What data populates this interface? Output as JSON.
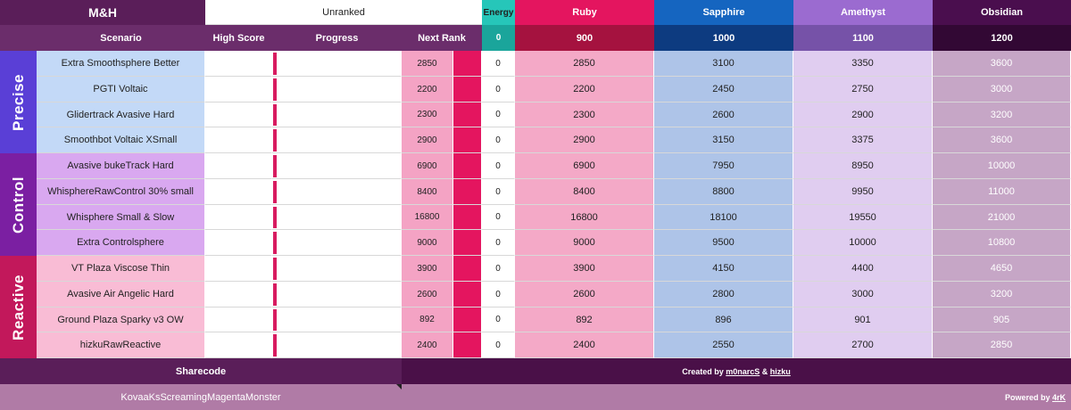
{
  "header": {
    "title": "M&H",
    "rank_status": "Unranked",
    "energy_label": "Energy",
    "energy_value": "0",
    "ranks": [
      {
        "name": "Ruby",
        "threshold": "900"
      },
      {
        "name": "Sapphire",
        "threshold": "1000"
      },
      {
        "name": "Amethyst",
        "threshold": "1100"
      },
      {
        "name": "Obsidian",
        "threshold": "1200"
      }
    ],
    "columns": {
      "scenario": "Scenario",
      "high_score": "High Score",
      "progress": "Progress",
      "next_rank": "Next Rank"
    }
  },
  "categories": [
    {
      "name": "Precise",
      "color": "#5a3fd6"
    },
    {
      "name": "Control",
      "color": "#7b1fa2"
    },
    {
      "name": "Reactive",
      "color": "#c2185b"
    }
  ],
  "scenarios": [
    {
      "name": "Extra Smoothsphere Better",
      "next_rank": "2850",
      "energy": "0",
      "ruby": "2850",
      "sapphire": "3100",
      "amethyst": "3350",
      "obsidian": "3600"
    },
    {
      "name": "PGTI Voltaic",
      "next_rank": "2200",
      "energy": "0",
      "ruby": "2200",
      "sapphire": "2450",
      "amethyst": "2750",
      "obsidian": "3000"
    },
    {
      "name": "Glidertrack Avasive Hard",
      "next_rank": "2300",
      "energy": "0",
      "ruby": "2300",
      "sapphire": "2600",
      "amethyst": "2900",
      "obsidian": "3200"
    },
    {
      "name": "Smoothbot Voltaic XSmall",
      "next_rank": "2900",
      "energy": "0",
      "ruby": "2900",
      "sapphire": "3150",
      "amethyst": "3375",
      "obsidian": "3600"
    },
    {
      "name": "Avasive bukeTrack Hard",
      "next_rank": "6900",
      "energy": "0",
      "ruby": "6900",
      "sapphire": "7950",
      "amethyst": "8950",
      "obsidian": "10000"
    },
    {
      "name": "WhisphereRawControl 30% small",
      "next_rank": "8400",
      "energy": "0",
      "ruby": "8400",
      "sapphire": "8800",
      "amethyst": "9950",
      "obsidian": "11000"
    },
    {
      "name": "Whisphere Small & Slow",
      "next_rank": "16800",
      "energy": "0",
      "ruby": "16800",
      "sapphire": "18100",
      "amethyst": "19550",
      "obsidian": "21000"
    },
    {
      "name": "Extra Controlsphere",
      "next_rank": "9000",
      "energy": "0",
      "ruby": "9000",
      "sapphire": "9500",
      "amethyst": "10000",
      "obsidian": "10800"
    },
    {
      "name": "VT Plaza Viscose Thin",
      "next_rank": "3900",
      "energy": "0",
      "ruby": "3900",
      "sapphire": "4150",
      "amethyst": "4400",
      "obsidian": "4650"
    },
    {
      "name": "Avasive Air Angelic Hard",
      "next_rank": "2600",
      "energy": "0",
      "ruby": "2600",
      "sapphire": "2800",
      "amethyst": "3000",
      "obsidian": "3200"
    },
    {
      "name": "Ground Plaza Sparky v3 OW",
      "next_rank": "892",
      "energy": "0",
      "ruby": "892",
      "sapphire": "896",
      "amethyst": "901",
      "obsidian": "905"
    },
    {
      "name": "hizkuRawReactive",
      "next_rank": "2400",
      "energy": "0",
      "ruby": "2400",
      "sapphire": "2550",
      "amethyst": "2700",
      "obsidian": "2850"
    }
  ],
  "footer": {
    "sharecode_label": "Sharecode",
    "sharecode_value": "KovaaKsScreamingMagentaMonster",
    "credits_prefix": "Created by ",
    "author1": "m0narcS",
    "credits_and": " & ",
    "author2": "hizku",
    "powered_prefix": "Powered by ",
    "powered_link": "4rK"
  },
  "colors": {
    "header_dark": "#5a1e59",
    "header_purple": "#6b2d6b",
    "energy_teal": "#26c6b9",
    "ruby": "#e4155f",
    "ruby_dark": "#a5123f",
    "sapphire": "#1565c0",
    "sapphire_dark": "#0d3b80",
    "amethyst": "#9b6bd0",
    "amethyst_dark": "#7652a8",
    "obsidian": "#4a0e4e",
    "obsidian_dark": "#320834"
  }
}
